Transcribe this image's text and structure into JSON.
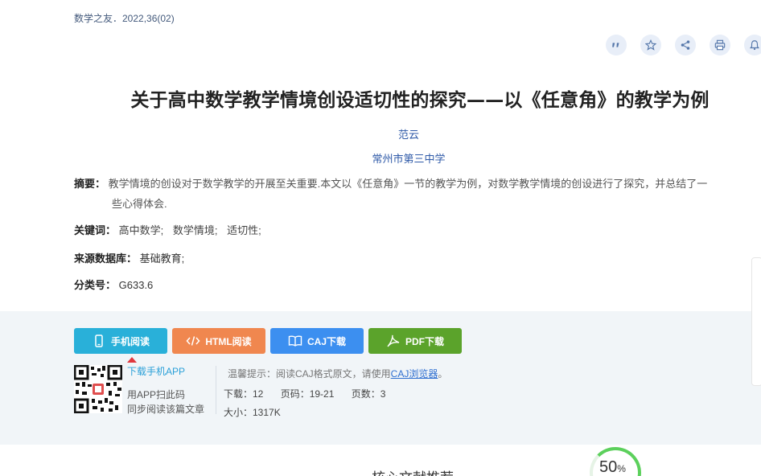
{
  "source": "数学之友．2022,36(02)",
  "toolbar": {
    "icons": [
      "quote-icon",
      "star-icon",
      "share-icon",
      "print-icon",
      "bell-icon"
    ]
  },
  "article": {
    "title": "关于高中数学教学情境创设适切性的探究——以《任意角》的教学为例",
    "author": "范云",
    "organization": "常州市第三中学",
    "abstract_label": "摘要：",
    "abstract_line1": "教学情境的创设对于数学教学的开展至关重要.本文以《任意角》一节的教学为例，对数学教学情境的创设进行了探究，并总结了一",
    "abstract_line2": "些心得体会.",
    "keywords_label": "关键词：",
    "keywords": [
      "高中数学;",
      "数学情境;",
      "适切性;"
    ],
    "database_label": "来源数据库：",
    "database": "基础教育;",
    "class_label": "分类号：",
    "class_no": "G633.6"
  },
  "actions": {
    "mobile_read": "手机阅读",
    "html_read": "HTML阅读",
    "caj_download": "CAJ下载",
    "pdf_download": "PDF下载"
  },
  "app": {
    "link": "下载手机APP",
    "line1": "用APP扫此码",
    "line2": "同步阅读该篇文章"
  },
  "tip": {
    "text": "温馨提示：阅读CAJ格式原文，请使用",
    "link": "CAJ浏览器",
    "suffix": "。"
  },
  "stats": {
    "downloads": "下载：12",
    "pages": "页码：19-21",
    "page_count": "页数：3",
    "size": "大小：1317K"
  },
  "recommend_title": "核心文献推荐",
  "progress": {
    "value": "50",
    "unit": "%",
    "fraction": 0.5
  },
  "colors": {
    "mobile": "#29b0d9",
    "html": "#f0874f",
    "caj": "#3c8ff0",
    "pdf": "#5ba32b",
    "link": "#2f5aa8"
  }
}
